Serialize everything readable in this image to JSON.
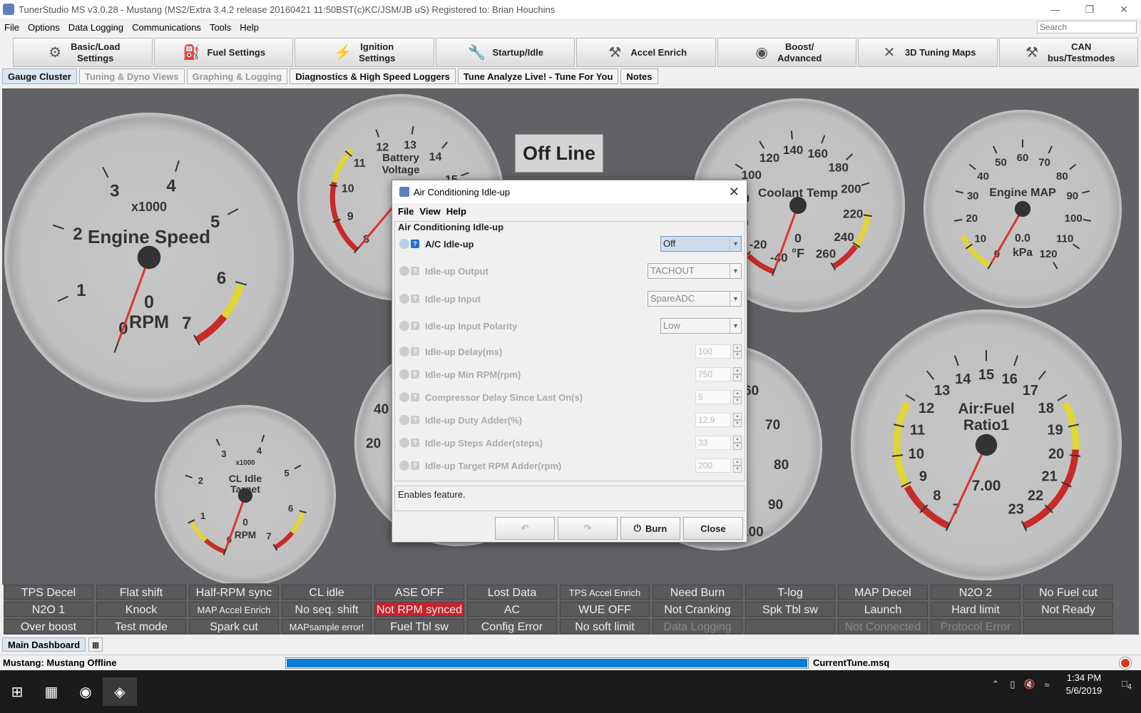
{
  "window": {
    "title": "TunerStudio MS v3.0.28 - Mustang (MS2/Extra 3.4.2 release  20160421 11:50BST(c)KC/JSM/JB   uS) Registered to: Brian Houchins"
  },
  "menu": [
    "File",
    "Options",
    "Data Logging",
    "Communications",
    "Tools",
    "Help"
  ],
  "search": {
    "placeholder": "Search"
  },
  "toolbar": [
    {
      "label": "Basic/Load\nSettings",
      "icon": "gear-icon"
    },
    {
      "label": "Fuel Settings",
      "icon": "fuel-injector-icon"
    },
    {
      "label": "Ignition\nSettings",
      "icon": "spark-plug-icon"
    },
    {
      "label": "Startup/Idle",
      "icon": "wrench-icon"
    },
    {
      "label": "Accel Enrich",
      "icon": "tools-icon"
    },
    {
      "label": "Boost/\nAdvanced",
      "icon": "turbo-icon"
    },
    {
      "label": "3D Tuning Maps",
      "icon": "crossed-tools-icon"
    },
    {
      "label": "CAN\nbus/Testmodes",
      "icon": "hammer-icon"
    }
  ],
  "tabs": [
    {
      "label": "Gauge Cluster",
      "state": "active"
    },
    {
      "label": "Tuning & Dyno Views",
      "state": "dim"
    },
    {
      "label": "Graphing & Logging",
      "state": "dim"
    },
    {
      "label": "Diagnostics & High Speed Loggers",
      "state": "normal"
    },
    {
      "label": "Tune Analyze Live! - Tune For You",
      "state": "normal"
    },
    {
      "label": "Notes",
      "state": "normal"
    }
  ],
  "offline_label": "Off Line",
  "gauges": {
    "engine_speed": {
      "title": "Engine Speed",
      "multiplier": "x1000",
      "value": "0",
      "units": "RPM",
      "ticks": [
        "0",
        "1",
        "2",
        "3",
        "4",
        "5",
        "6",
        "7"
      ]
    },
    "battery": {
      "title": "Battery\nVoltage",
      "ticks": [
        "8",
        "9",
        "10",
        "11",
        "12",
        "13",
        "14",
        "15"
      ]
    },
    "coolant": {
      "title": "Coolant Temp",
      "value": "0",
      "units": "°F",
      "ticks": [
        "-40",
        "-20",
        "0",
        "80",
        "100",
        "120",
        "140",
        "160",
        "180",
        "200",
        "220",
        "240",
        "260"
      ]
    },
    "map": {
      "title": "Engine MAP",
      "value": "0.0",
      "units": "kPa",
      "ticks": [
        "0",
        "10",
        "20",
        "30",
        "40",
        "50",
        "60",
        "70",
        "80",
        "90",
        "100",
        "110",
        "120"
      ]
    },
    "idle_target": {
      "title": "CL Idle\nTarget",
      "multiplier": "x1000",
      "value": "0",
      "units": "RPM",
      "ticks": [
        "0",
        "1",
        "2",
        "3",
        "4",
        "5",
        "6",
        "7"
      ]
    },
    "afr": {
      "title": "Air:Fuel\nRatio1",
      "value": "7.00",
      "ticks": [
        "7",
        "8",
        "9",
        "10",
        "11",
        "12",
        "13",
        "14",
        "15",
        "16",
        "17",
        "18",
        "19",
        "20",
        "21",
        "22",
        "23"
      ]
    },
    "partial_left": {
      "ticks": [
        "40",
        "20"
      ]
    },
    "partial_right": {
      "ticks": [
        "60",
        "70",
        "80",
        "90",
        "100"
      ]
    }
  },
  "indicators": [
    [
      "TPS Decel",
      "Flat shift",
      "Half-RPM sync",
      "CL idle",
      "ASE OFF",
      "Lost Data",
      "TPS Accel Enrich",
      "Need Burn",
      "T-log",
      "MAP Decel",
      "N2O 2",
      "No Fuel cut"
    ],
    [
      "N2O 1",
      "Knock",
      "MAP Accel Enrich",
      "No seq. shift",
      "Not RPM synced",
      "AC",
      "WUE OFF",
      "Not Cranking",
      "Spk Tbl sw",
      "Launch",
      "Hard limit",
      "Not Ready"
    ],
    [
      "Over boost",
      "Test mode",
      "Spark cut",
      "MAPsample error!",
      "Fuel Tbl sw",
      "Config Error",
      "No soft limit",
      "Data Logging",
      "",
      "Not Connected",
      "Protocol Error",
      ""
    ]
  ],
  "dash_tab": "Main Dashboard",
  "status": {
    "left": "Mustang: Mustang Offline",
    "file": "CurrentTune.msq",
    "progress": 1.0
  },
  "taskbar": {
    "time": "1:34 PM",
    "date": "5/6/2019",
    "notification_count": "4"
  },
  "dialog": {
    "title": "Air Conditioning Idle-up",
    "menu": [
      "File",
      "View",
      "Help"
    ],
    "group": "Air Conditioning Idle-up",
    "fields": [
      {
        "label": "A/C Idle-up",
        "kind": "select",
        "value": "Off",
        "enabled": true
      },
      {
        "label": "Idle-up Output",
        "kind": "select",
        "value": "TACHOUT",
        "enabled": false
      },
      {
        "label": "Idle-up Input",
        "kind": "select",
        "value": "SpareADC",
        "enabled": false
      },
      {
        "label": "Idle-up Input Polarity",
        "kind": "select",
        "value": "Low",
        "enabled": false
      },
      {
        "label": "Idle-up Delay(ms)",
        "kind": "spin",
        "value": "100",
        "enabled": false
      },
      {
        "label": "Idle-up Min RPM(rpm)",
        "kind": "spin",
        "value": "750",
        "enabled": false
      },
      {
        "label": "Compressor Delay Since Last On(s)",
        "kind": "spin",
        "value": "5",
        "enabled": false
      },
      {
        "label": "Idle-up Duty Adder(%)",
        "kind": "spin",
        "value": "12.9",
        "enabled": false
      },
      {
        "label": "Idle-up Steps Adder(steps)",
        "kind": "spin",
        "value": "33",
        "enabled": false
      },
      {
        "label": "Idle-up Target RPM Adder(rpm)",
        "kind": "spin",
        "value": "200",
        "enabled": false
      }
    ],
    "description": "Enables feature.",
    "buttons": {
      "burn": "Burn",
      "close": "Close"
    }
  }
}
